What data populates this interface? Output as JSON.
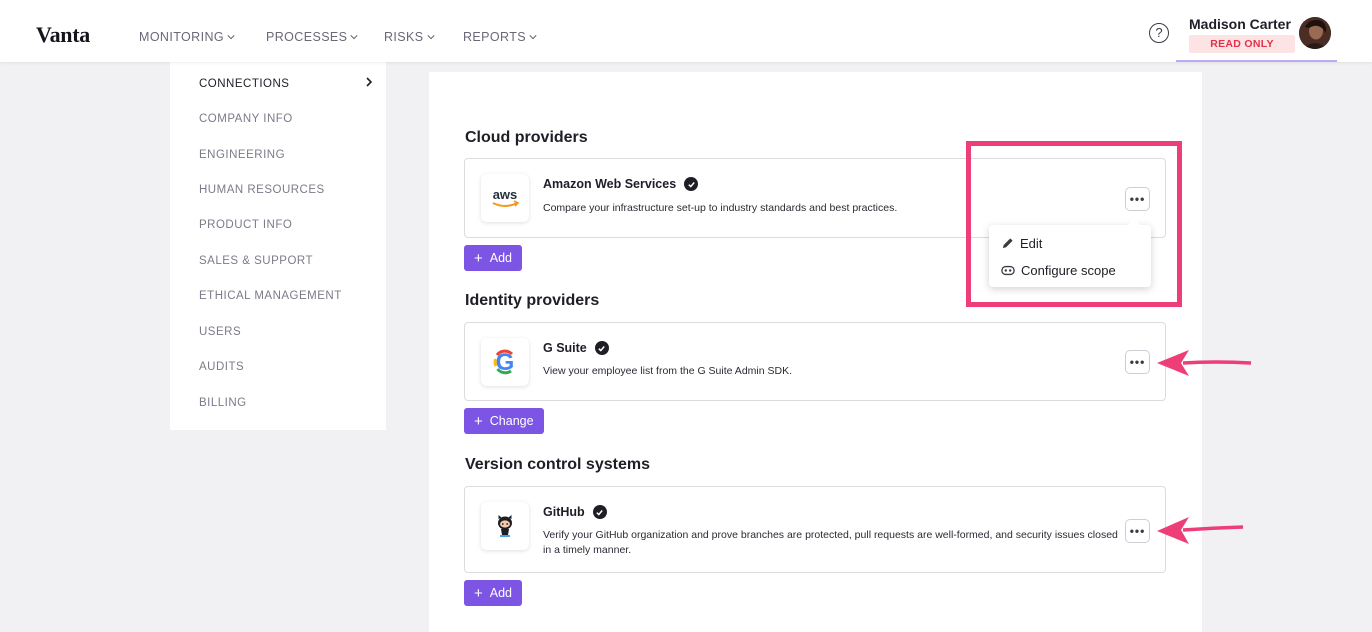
{
  "header": {
    "logo": "Vanta",
    "nav": [
      {
        "label": "MONITORING"
      },
      {
        "label": "PROCESSES"
      },
      {
        "label": "RISKS"
      },
      {
        "label": "REPORTS"
      }
    ],
    "help_glyph": "?",
    "user_name": "Madison Carter",
    "user_badge": "READ ONLY"
  },
  "sidebar": {
    "items": [
      {
        "label": "CONNECTIONS",
        "active": true
      },
      {
        "label": "COMPANY INFO"
      },
      {
        "label": "ENGINEERING"
      },
      {
        "label": "HUMAN RESOURCES"
      },
      {
        "label": "PRODUCT INFO"
      },
      {
        "label": "SALES & SUPPORT"
      },
      {
        "label": "ETHICAL MANAGEMENT"
      },
      {
        "label": "USERS"
      },
      {
        "label": "AUDITS"
      },
      {
        "label": "BILLING"
      }
    ]
  },
  "sections": [
    {
      "title": "Cloud providers",
      "card": {
        "name": "Amazon Web Services",
        "logo_text": "aws",
        "description": "Compare your infrastructure set-up to industry standards and best practices."
      },
      "button": "Add"
    },
    {
      "title": "Identity providers",
      "card": {
        "name": "G Suite",
        "logo_text": "G",
        "description": "View your employee list from the G Suite Admin SDK."
      },
      "button": "Change"
    },
    {
      "title": "Version control systems",
      "card": {
        "name": "GitHub",
        "description": "Verify your GitHub organization and prove branches are protected, pull requests are well-formed, and security issues closed in a timely manner."
      },
      "button": "Add"
    }
  ],
  "menu": {
    "items": [
      {
        "label": "Edit",
        "icon": "pencil-icon"
      },
      {
        "label": "Configure scope",
        "icon": "scope-icon"
      }
    ]
  },
  "more_glyph": "•••",
  "plus_glyph": "+",
  "colors": {
    "accent": "#7c55e4",
    "annotation": "#ee3e78",
    "badge_bg": "#fde3e4",
    "badge_text": "#e0324b"
  }
}
